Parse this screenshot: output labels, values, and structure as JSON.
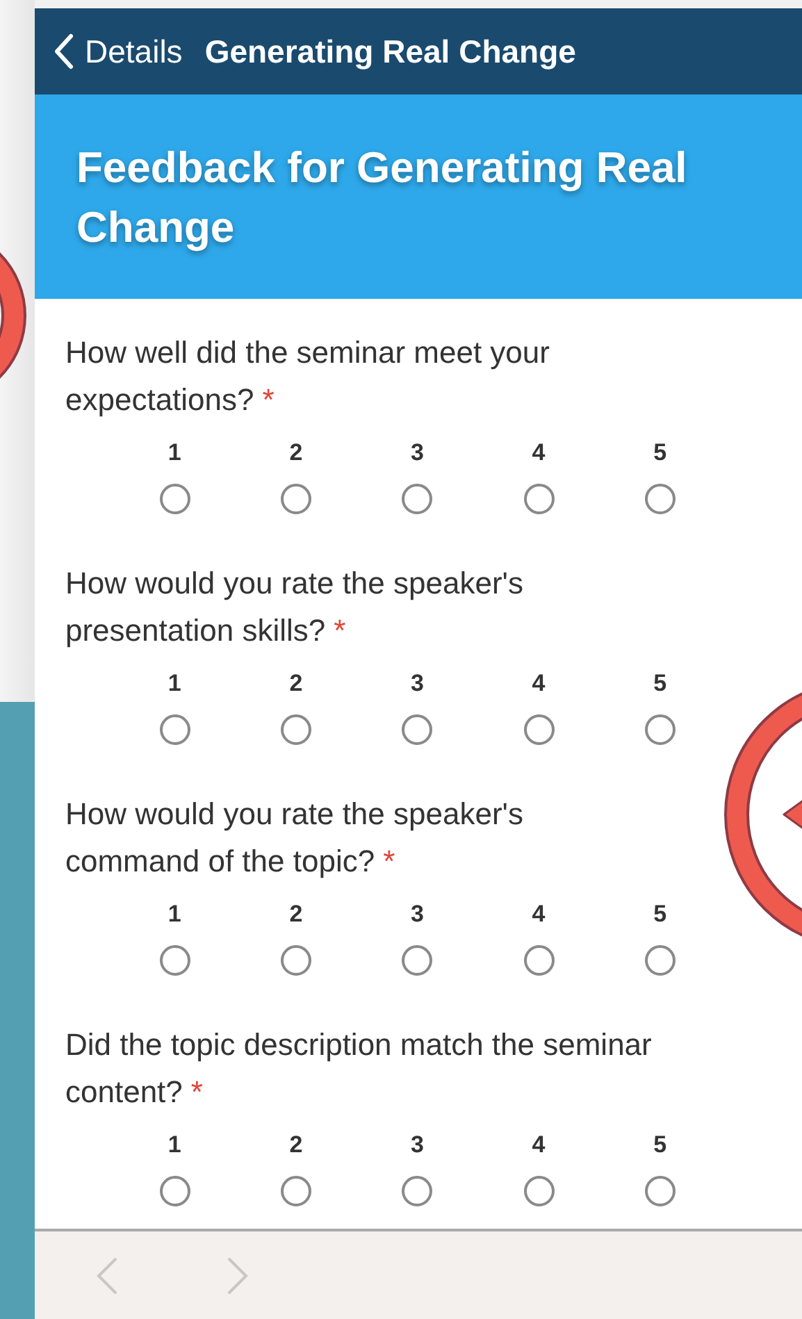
{
  "nav_bar": {
    "back_label": "Details",
    "title": "Generating Real Change"
  },
  "banner": {
    "title": "Feedback for Generating Real Change"
  },
  "questions": [
    {
      "text": "How well did the seminar meet your expectations?",
      "required": true,
      "required_mark": "*",
      "options": [
        {
          "label": "1",
          "selected": false
        },
        {
          "label": "2",
          "selected": false
        },
        {
          "label": "3",
          "selected": false
        },
        {
          "label": "4",
          "selected": false
        },
        {
          "label": "5",
          "selected": false
        }
      ]
    },
    {
      "text": "How would you rate the speaker's presentation skills?",
      "required": true,
      "required_mark": "*",
      "options": [
        {
          "label": "1",
          "selected": false
        },
        {
          "label": "2",
          "selected": false
        },
        {
          "label": "3",
          "selected": false
        },
        {
          "label": "4",
          "selected": false
        },
        {
          "label": "5",
          "selected": false
        }
      ]
    },
    {
      "text": "How would you rate the speaker's command of the topic?",
      "required": true,
      "required_mark": "*",
      "options": [
        {
          "label": "1",
          "selected": false
        },
        {
          "label": "2",
          "selected": false
        },
        {
          "label": "3",
          "selected": false
        },
        {
          "label": "4",
          "selected": false
        },
        {
          "label": "5",
          "selected": false
        }
      ]
    },
    {
      "text": "Did the topic description match the seminar content?",
      "required": true,
      "required_mark": "*",
      "options": [
        {
          "label": "1",
          "selected": false
        },
        {
          "label": "2",
          "selected": false
        },
        {
          "label": "3",
          "selected": false
        },
        {
          "label": "4",
          "selected": false
        },
        {
          "label": "5",
          "selected": false
        }
      ]
    }
  ],
  "footer": {
    "previous": {
      "disabled": true
    },
    "next": {
      "disabled": true
    }
  }
}
